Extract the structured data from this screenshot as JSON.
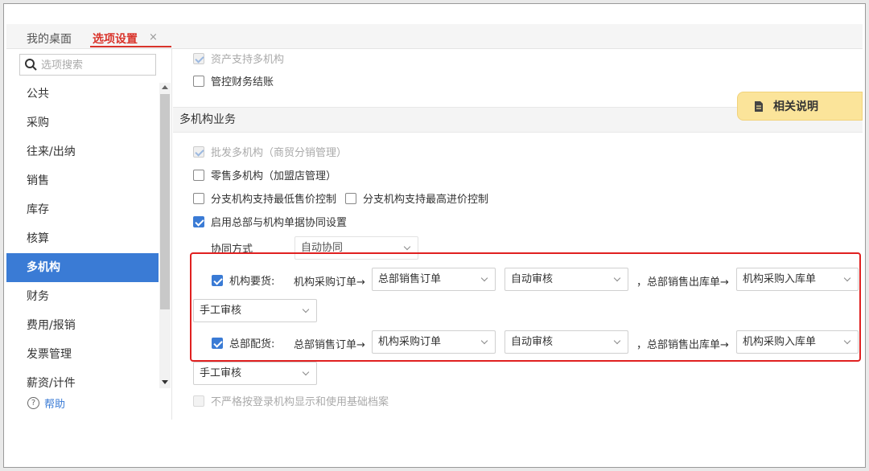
{
  "tabs": {
    "desktop": "我的桌面",
    "options": "选项设置",
    "close": "×"
  },
  "sidebar": {
    "search_placeholder": "选项搜索",
    "items": [
      "公共",
      "采购",
      "往来/出纳",
      "销售",
      "库存",
      "核算",
      "多机构",
      "财务",
      "费用/报销",
      "发票管理",
      "薪资/计件"
    ],
    "active_item": "多机构",
    "help_label": "帮助"
  },
  "main": {
    "top_options": {
      "asset_multi_org": "资产支持多机构",
      "control_finance_close": "管控财务结账"
    },
    "section_title": "多机构业务",
    "related_button": "相关说明",
    "options": {
      "wholesale_multi_org": "批发多机构（商贸分销管理）",
      "retail_multi_org": "零售多机构（加盟店管理）",
      "branch_min_price": "分支机构支持最低售价控制",
      "branch_max_price": "分支机构支持最高进价控制",
      "enable_sync": "启用总部与机构单据协同设置"
    },
    "sync_mode_label": "协同方式",
    "sync_mode_value": "自动协同",
    "org_request": {
      "label": "机构要货:",
      "flow1": "机构采购订单→",
      "select1": "总部销售订单",
      "select2": "自动审核",
      "flow2": "，总部销售出库单→",
      "select3": "机构采购入库单",
      "select4": "手工审核"
    },
    "hq_distribution": {
      "label": "总部配货:",
      "flow1": "总部销售订单→",
      "select1": "机构采购订单",
      "select2": "自动审核",
      "flow2": "，总部销售出库单→",
      "select3": "机构采购入库单",
      "select4": "手工审核"
    },
    "bottom_option": "不严格按登录机构显示和使用基础档案"
  },
  "colors": {
    "accent_blue": "#3a7bd5",
    "tab_active_red": "#d9342b",
    "highlight_red": "#e02020",
    "related_button_bg": "#fbe49a"
  }
}
